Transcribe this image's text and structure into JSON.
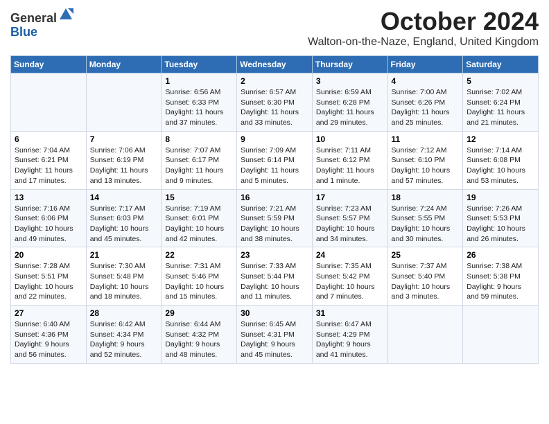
{
  "header": {
    "logo_general": "General",
    "logo_blue": "Blue",
    "month_title": "October 2024",
    "location": "Walton-on-the-Naze, England, United Kingdom"
  },
  "days_of_week": [
    "Sunday",
    "Monday",
    "Tuesday",
    "Wednesday",
    "Thursday",
    "Friday",
    "Saturday"
  ],
  "weeks": [
    [
      {
        "day": "",
        "detail": ""
      },
      {
        "day": "",
        "detail": ""
      },
      {
        "day": "1",
        "detail": "Sunrise: 6:56 AM\nSunset: 6:33 PM\nDaylight: 11 hours and 37 minutes."
      },
      {
        "day": "2",
        "detail": "Sunrise: 6:57 AM\nSunset: 6:30 PM\nDaylight: 11 hours and 33 minutes."
      },
      {
        "day": "3",
        "detail": "Sunrise: 6:59 AM\nSunset: 6:28 PM\nDaylight: 11 hours and 29 minutes."
      },
      {
        "day": "4",
        "detail": "Sunrise: 7:00 AM\nSunset: 6:26 PM\nDaylight: 11 hours and 25 minutes."
      },
      {
        "day": "5",
        "detail": "Sunrise: 7:02 AM\nSunset: 6:24 PM\nDaylight: 11 hours and 21 minutes."
      }
    ],
    [
      {
        "day": "6",
        "detail": "Sunrise: 7:04 AM\nSunset: 6:21 PM\nDaylight: 11 hours and 17 minutes."
      },
      {
        "day": "7",
        "detail": "Sunrise: 7:06 AM\nSunset: 6:19 PM\nDaylight: 11 hours and 13 minutes."
      },
      {
        "day": "8",
        "detail": "Sunrise: 7:07 AM\nSunset: 6:17 PM\nDaylight: 11 hours and 9 minutes."
      },
      {
        "day": "9",
        "detail": "Sunrise: 7:09 AM\nSunset: 6:14 PM\nDaylight: 11 hours and 5 minutes."
      },
      {
        "day": "10",
        "detail": "Sunrise: 7:11 AM\nSunset: 6:12 PM\nDaylight: 11 hours and 1 minute."
      },
      {
        "day": "11",
        "detail": "Sunrise: 7:12 AM\nSunset: 6:10 PM\nDaylight: 10 hours and 57 minutes."
      },
      {
        "day": "12",
        "detail": "Sunrise: 7:14 AM\nSunset: 6:08 PM\nDaylight: 10 hours and 53 minutes."
      }
    ],
    [
      {
        "day": "13",
        "detail": "Sunrise: 7:16 AM\nSunset: 6:06 PM\nDaylight: 10 hours and 49 minutes."
      },
      {
        "day": "14",
        "detail": "Sunrise: 7:17 AM\nSunset: 6:03 PM\nDaylight: 10 hours and 45 minutes."
      },
      {
        "day": "15",
        "detail": "Sunrise: 7:19 AM\nSunset: 6:01 PM\nDaylight: 10 hours and 42 minutes."
      },
      {
        "day": "16",
        "detail": "Sunrise: 7:21 AM\nSunset: 5:59 PM\nDaylight: 10 hours and 38 minutes."
      },
      {
        "day": "17",
        "detail": "Sunrise: 7:23 AM\nSunset: 5:57 PM\nDaylight: 10 hours and 34 minutes."
      },
      {
        "day": "18",
        "detail": "Sunrise: 7:24 AM\nSunset: 5:55 PM\nDaylight: 10 hours and 30 minutes."
      },
      {
        "day": "19",
        "detail": "Sunrise: 7:26 AM\nSunset: 5:53 PM\nDaylight: 10 hours and 26 minutes."
      }
    ],
    [
      {
        "day": "20",
        "detail": "Sunrise: 7:28 AM\nSunset: 5:51 PM\nDaylight: 10 hours and 22 minutes."
      },
      {
        "day": "21",
        "detail": "Sunrise: 7:30 AM\nSunset: 5:48 PM\nDaylight: 10 hours and 18 minutes."
      },
      {
        "day": "22",
        "detail": "Sunrise: 7:31 AM\nSunset: 5:46 PM\nDaylight: 10 hours and 15 minutes."
      },
      {
        "day": "23",
        "detail": "Sunrise: 7:33 AM\nSunset: 5:44 PM\nDaylight: 10 hours and 11 minutes."
      },
      {
        "day": "24",
        "detail": "Sunrise: 7:35 AM\nSunset: 5:42 PM\nDaylight: 10 hours and 7 minutes."
      },
      {
        "day": "25",
        "detail": "Sunrise: 7:37 AM\nSunset: 5:40 PM\nDaylight: 10 hours and 3 minutes."
      },
      {
        "day": "26",
        "detail": "Sunrise: 7:38 AM\nSunset: 5:38 PM\nDaylight: 9 hours and 59 minutes."
      }
    ],
    [
      {
        "day": "27",
        "detail": "Sunrise: 6:40 AM\nSunset: 4:36 PM\nDaylight: 9 hours and 56 minutes."
      },
      {
        "day": "28",
        "detail": "Sunrise: 6:42 AM\nSunset: 4:34 PM\nDaylight: 9 hours and 52 minutes."
      },
      {
        "day": "29",
        "detail": "Sunrise: 6:44 AM\nSunset: 4:32 PM\nDaylight: 9 hours and 48 minutes."
      },
      {
        "day": "30",
        "detail": "Sunrise: 6:45 AM\nSunset: 4:31 PM\nDaylight: 9 hours and 45 minutes."
      },
      {
        "day": "31",
        "detail": "Sunrise: 6:47 AM\nSunset: 4:29 PM\nDaylight: 9 hours and 41 minutes."
      },
      {
        "day": "",
        "detail": ""
      },
      {
        "day": "",
        "detail": ""
      }
    ]
  ]
}
